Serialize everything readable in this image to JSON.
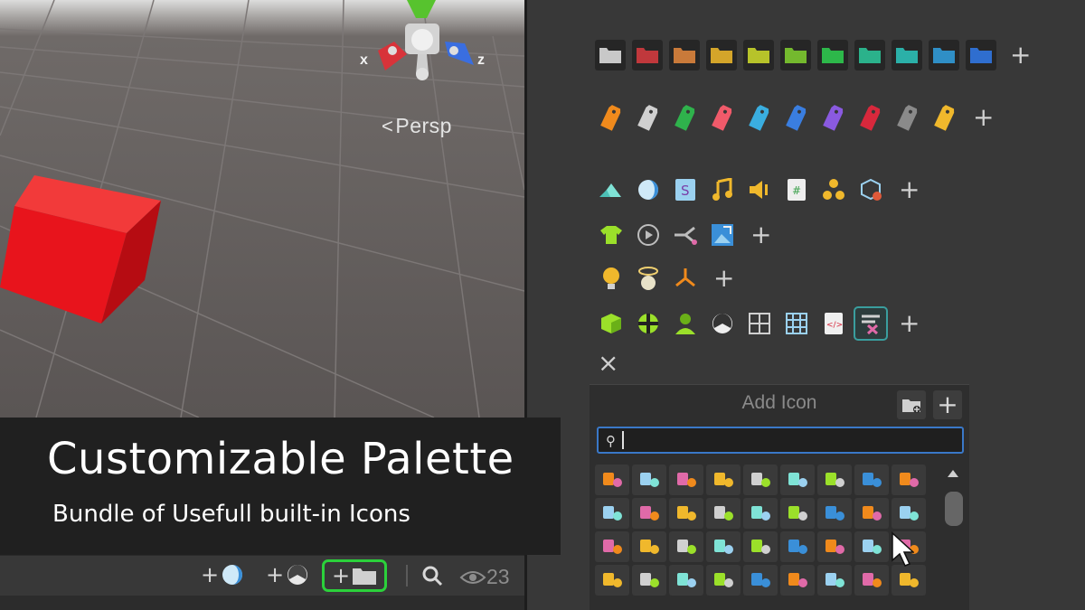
{
  "scene": {
    "projection_label": "Persp",
    "projection_arrow": "<",
    "axis_x": "x",
    "axis_z": "z"
  },
  "colors": {
    "folder_colors": [
      "#c8c8c8",
      "#c0383c",
      "#c97a3a",
      "#d4a52a",
      "#b7c32a",
      "#74b92e",
      "#2db84a",
      "#2bb28b",
      "#2bb0a8",
      "#2f8fc6",
      "#2f6ecf"
    ],
    "tag_colors": [
      "#f08a1c",
      "#d0d0d0",
      "#2fb24c",
      "#f05a6a",
      "#3aaee0",
      "#3a7ee0",
      "#8a5ae0",
      "#d8283c",
      "#8a8a8a",
      "#f0b82c"
    ],
    "accent_cube": "#e8141c",
    "selection_outline": "#3a9e9e",
    "highlight_green": "#2bd13b",
    "search_border": "#3a78c8"
  },
  "palette": {
    "row_icons_1": [
      "terrain-icon",
      "sphere-icon",
      "shader-icon",
      "audio-clip-icon",
      "audio-source-icon",
      "script-icon",
      "particles-icon",
      "prefab-variant-icon"
    ],
    "row_icons_2": [
      "shirt-icon",
      "play-circle-icon",
      "branch-icon",
      "image-icon"
    ],
    "row_icons_3": [
      "light-bulb-icon",
      "halo-icon",
      "joint-icon"
    ],
    "row_icons_4": [
      "cube-icon",
      "material-ball-icon",
      "avatar-icon",
      "physics-icon",
      "grid-icon",
      "table-grid-icon",
      "html-icon",
      "sort-icon"
    ],
    "close_label": "×",
    "add_label": "+"
  },
  "popup": {
    "title": "Add Icon",
    "add_label": "+",
    "search_icon": "⚲",
    "search_value": "",
    "grid_icons": [
      "run-icon",
      "barrier-icon",
      "runner-icon",
      "image-icon",
      "branch-icon",
      "play-circle-icon",
      "terrain-icon",
      "hierarchy-icon",
      "avatar-icon",
      "humanoid-icon",
      "terrain-icon",
      "clock-icon",
      "joint-icon",
      "clock-icon",
      "edit-icon",
      "flag-icon",
      "sort-icon",
      "audio-source-icon",
      "ramp-icon",
      "wedge-icon",
      "tree-icon",
      "audio-clip-icon",
      "headphones-icon",
      "rig-icon",
      "broom-icon",
      "warning-icon",
      "particles-icon",
      "film-icon",
      "shirt-icon",
      "camera-icon",
      "export-icon",
      "disc-icon",
      "light-bulb-icon",
      "picture-icon",
      "eye-icon",
      "blobs-icon"
    ]
  },
  "caption": {
    "title": "Customizable Palette",
    "subtitle": "Bundle of Usefull built-in Icons"
  },
  "toolbar": {
    "plus": "+",
    "visible_count": "23",
    "buttons": [
      "add-sphere-button",
      "add-physics-button",
      "add-folder-button",
      "search-button",
      "visibility-toggle"
    ]
  }
}
